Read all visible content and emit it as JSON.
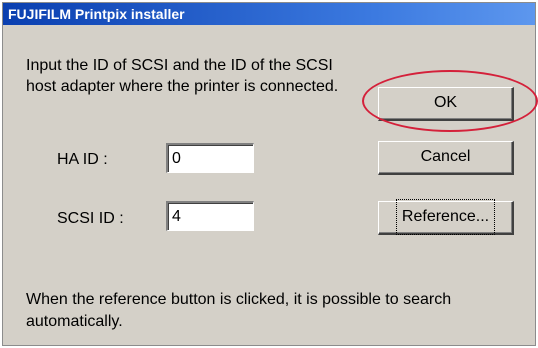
{
  "window": {
    "title": "FUJIFILM Printpix installer"
  },
  "instruction": {
    "line1": "Input the ID of SCSI and the ID of the SCSI",
    "line2": "host adapter where the printer is connected."
  },
  "fields": {
    "ha_id": {
      "label": "HA ID :",
      "value": "0"
    },
    "scsi_id": {
      "label": "SCSI ID :",
      "value": "4"
    }
  },
  "buttons": {
    "ok": "OK",
    "cancel": "Cancel",
    "reference": "Reference..."
  },
  "footer": {
    "line1": "When the reference button is clicked, it is possible to search",
    "line2": "automatically."
  },
  "colors": {
    "titlebar": "#0a3fb0",
    "dialog_bg": "#d4d0c8",
    "highlight": "#d4203a"
  }
}
